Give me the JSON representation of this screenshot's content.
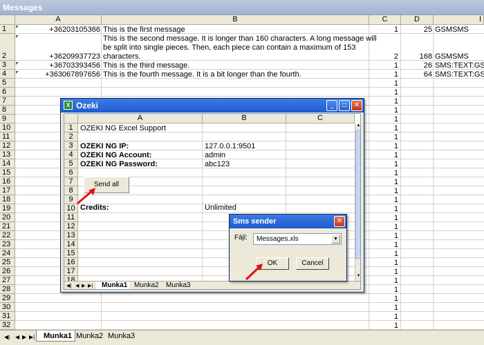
{
  "window": {
    "title": "Messages"
  },
  "sheet": {
    "columns": [
      "A",
      "B",
      "C",
      "D",
      "I"
    ],
    "rows": [
      {
        "num": "1",
        "phone": "+36203105366",
        "message": [
          "This is the first message"
        ],
        "c": "1",
        "d": "25",
        "e": "GSMSMS"
      },
      {
        "num": "2",
        "phone": "+36209937723",
        "message": [
          "This is the second message. It is longer than 160 characters. A long message will",
          "be split into single pieces. Then, each piece can contain a maximum of 153",
          "characters."
        ],
        "c": "2",
        "d": "168",
        "e": "GSMSMS"
      },
      {
        "num": "3",
        "phone": "+36703393456",
        "message": [
          "This is the third message."
        ],
        "c": "1",
        "d": "26",
        "e": "SMS:TEXT:GS"
      },
      {
        "num": "4",
        "phone": "+363067897656",
        "message": [
          "This is the fourth message. It is a bit longer than the fourth."
        ],
        "c": "1",
        "d": "64",
        "e": "SMS:TEXT:GS"
      }
    ],
    "empty_row_numbers": [
      "5",
      "6",
      "7",
      "8",
      "9",
      "10",
      "11",
      "12",
      "13",
      "14",
      "15",
      "16",
      "17",
      "18",
      "19",
      "20",
      "21",
      "22",
      "23",
      "24",
      "25",
      "26",
      "27",
      "28",
      "29",
      "30",
      "31",
      "32"
    ],
    "column_c_fill": "1"
  },
  "outer_tabs": [
    "Munka1",
    "Munka2",
    "Munka3"
  ],
  "ozeki": {
    "title": "Ozeki",
    "columns": [
      "A",
      "B",
      "C"
    ],
    "row_numbers": [
      "1",
      "2",
      "3",
      "4",
      "5",
      "6",
      "7",
      "8",
      "9",
      "10",
      "11",
      "12",
      "13",
      "14",
      "15",
      "16",
      "17",
      "18"
    ],
    "cells": {
      "a1": "OZEKI NG Excel Support",
      "a3": "OZEKI NG IP:",
      "b3": "127.0.0.1:9501",
      "a4": "OZEKI NG Account:",
      "b4": "admin",
      "a5": "OZEKI NG Password:",
      "b5": "abc123",
      "a10": "Credits:",
      "b10": "Unlimited"
    },
    "send_all_label": "Send all",
    "tabs": [
      "Munka1",
      "Munka2",
      "Munka3"
    ]
  },
  "sms_dialog": {
    "title": "Sms sender",
    "file_label": "Fájl:",
    "file_value": "Messages.xls",
    "ok_label": "OK",
    "cancel_label": "Cancel"
  },
  "colors": {
    "titlebar": "#1f5ad0",
    "arrow": "#e01010",
    "grid": "#d4d0c8",
    "header": "#ece9d8"
  }
}
